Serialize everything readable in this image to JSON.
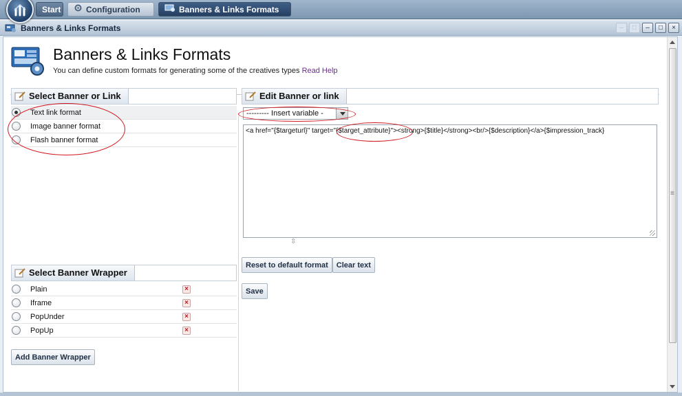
{
  "taskbar": {
    "start_label": "Start",
    "tabs": [
      {
        "label": "Configuration",
        "icon": "gear-icon"
      },
      {
        "label": "Banners & Links Formats",
        "icon": "banners-icon"
      }
    ]
  },
  "window": {
    "title": "Banners & Links Formats",
    "controls": [
      "minimize",
      "restore",
      "close"
    ]
  },
  "page": {
    "title": "Banners & Links Formats",
    "subtitle": "You can define custom formats for generating some of the creatives types",
    "help_link": "Read Help"
  },
  "select_panel": {
    "title": "Select Banner or Link",
    "options": [
      {
        "label": "Text link format",
        "selected": true
      },
      {
        "label": "Image banner format",
        "selected": false
      },
      {
        "label": "Flash banner format",
        "selected": false
      }
    ]
  },
  "wrapper_panel": {
    "title": "Select Banner Wrapper",
    "items": [
      {
        "label": "Plain"
      },
      {
        "label": "Iframe"
      },
      {
        "label": "PopUnder"
      },
      {
        "label": "PopUp"
      }
    ],
    "add_button": "Add Banner Wrapper"
  },
  "edit_panel": {
    "title": "Edit Banner or link",
    "insert_variable": "---------  Insert variable  -",
    "code": "<a href=\"{$targeturl}\" target=\"{$target_attribute}\"><strong>{$title}</strong><br/>{$description}</a>{$impression_track}",
    "reset_button": "Reset to default format",
    "clear_button": "Clear text",
    "save_button": "Save"
  },
  "colors": {
    "annotation_ring": "#d1141c",
    "help_link": "#6c2d8e",
    "taskbar_active": "#253f61"
  }
}
